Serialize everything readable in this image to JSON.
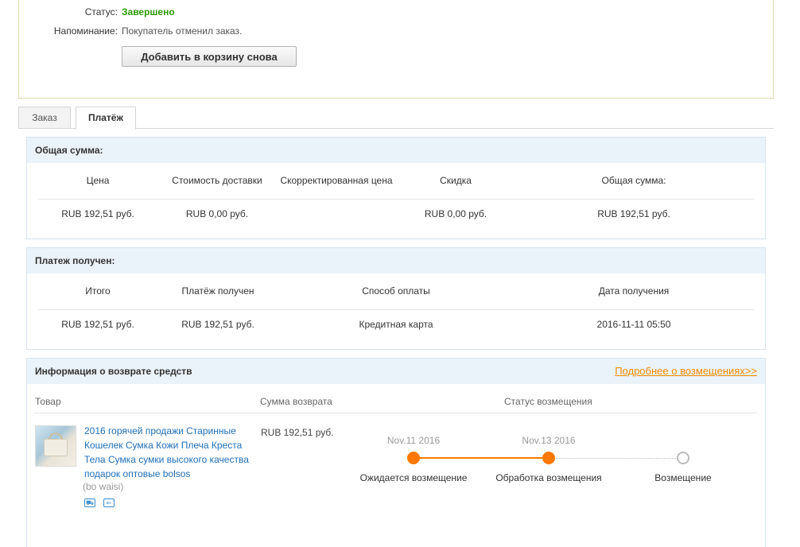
{
  "status": {
    "status_label": "Статус:",
    "status_value": "Завершено",
    "reminder_label": "Напоминание:",
    "reminder_value": "Покупатель отменил заказ.",
    "readd_button": "Добавить в корзину снова"
  },
  "tabs": [
    {
      "label": "Заказ",
      "active": false
    },
    {
      "label": "Платёж",
      "active": true
    }
  ],
  "total_panel": {
    "title": "Общая сумма:",
    "headers": [
      "Цена",
      "Стоимость доставки",
      "Скорректированная цена",
      "Скидка",
      "Общая сумма:"
    ],
    "values": [
      "RUB 192,51 руб.",
      "RUB 0,00 руб.",
      "",
      "RUB 0,00 руб.",
      "RUB 192,51 руб."
    ]
  },
  "payment_panel": {
    "title": "Платеж получен:",
    "headers": [
      "Итого",
      "Платёж получен",
      "Способ оплаты",
      "Дата получения"
    ],
    "values": [
      "RUB 192,51 руб.",
      "RUB 192,51 руб.",
      "Кредитная карта",
      "2016-11-11 05:50"
    ]
  },
  "refund_panel": {
    "title": "Информация о возврате средств",
    "more_link": "Подробнее о возмещениях>>",
    "col_product": "Товар",
    "col_amount": "Сумма возврата",
    "col_status": "Статус возмещения",
    "product_title": "2016 горячей продажи Старинные Кошелек Сумка Кожи Плеча Креста Тела Сумка сумки высокого качества подарок оптовые bolsos",
    "product_sub": "(bo waisi)",
    "amount": "RUB 192,51 руб.",
    "steps": [
      {
        "date": "Nov.11 2016",
        "label": "Ожидается возмещение",
        "done": true
      },
      {
        "date": "Nov.13 2016",
        "label": "Обработка возмещения",
        "done": true
      },
      {
        "date": "",
        "label": "Возмещение",
        "done": false
      }
    ],
    "progress_color": "#ff7900"
  },
  "colors": {
    "status_green": "#2c9a05",
    "link_blue": "#1e6fb8",
    "link_orange": "#f08c00",
    "panel_header_bg": "#eaf2fa"
  },
  "icons": [
    "shipping-icon",
    "return-icon"
  ]
}
